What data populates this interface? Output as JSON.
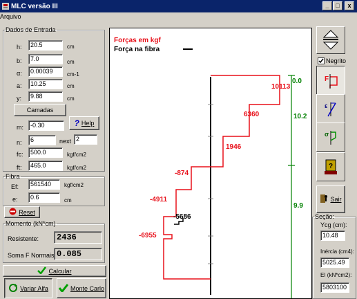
{
  "window": {
    "title": "MLC versão III",
    "min_label": "_",
    "max_label": "□",
    "close_label": "x"
  },
  "menu": {
    "arquivo": "Arquivo"
  },
  "entrada": {
    "legend": "Dados de Entrada",
    "h": {
      "label": "h:",
      "value": "20.5",
      "unit": "cm"
    },
    "b": {
      "label": "b:",
      "value": "7.0",
      "unit": "cm"
    },
    "alpha": {
      "label": "α:",
      "value": "0.00039",
      "unit": "cm-1"
    },
    "a": {
      "label": "a:",
      "value": "10.25",
      "unit": "cm"
    },
    "y": {
      "label": "y:",
      "value": "9.88",
      "unit": "cm"
    },
    "camadas_label": "Camadas",
    "m": {
      "label": "m:",
      "value": "-0.30"
    },
    "help_label": "Help",
    "n": {
      "label": "n:",
      "value": "6"
    },
    "next": {
      "label": "next",
      "value": "2"
    },
    "fc": {
      "label": "fc:",
      "value": "500.0",
      "unit": "kgf/cm2"
    },
    "ft": {
      "label": "ft:",
      "value": "465.0",
      "unit": "kgf/cm2"
    }
  },
  "fibra": {
    "legend": "Fibra",
    "ef": {
      "label": "Ef:",
      "value": "561540",
      "unit": "kgf/cm2"
    },
    "e": {
      "label": "e:",
      "value": "0.6",
      "unit": "cm"
    }
  },
  "reset_label": "Reset",
  "momento": {
    "legend": "Momento (kN*cm)",
    "resistente_label": "Resistente:",
    "resistente_value": "2436",
    "soma_label": "Soma F Normais:",
    "soma_value": "0.085"
  },
  "calcular_label": "Calcular",
  "variar_label": "Variar Alfa",
  "monte_carlo_label": "Monte Carlo",
  "canvas": {
    "title_forcas": "Forças em kgf",
    "title_fibra": "Força na fibra",
    "forces": [
      "10113",
      "6360",
      "1946",
      "-874",
      "-4911",
      "-5686",
      "-6955"
    ],
    "dim_top": "0.0",
    "dim_mid": "10.2",
    "dim_bot": "9.9"
  },
  "right": {
    "negrito_label": "Negrito",
    "sair_label": "Sair",
    "secao_legend": "Seção:",
    "ycg_label": "Ycg (cm):",
    "ycg_value": "10.48",
    "inercia_label": "Inércia (cm4):",
    "inercia_value": "5025.49",
    "ei_label": "EI (kN*cm2):",
    "ei_value": "5803100"
  },
  "colors": {
    "titlebar": "#0a246a",
    "force": "#e8101a",
    "dimension": "#008000",
    "face": "#d4d0c8"
  }
}
